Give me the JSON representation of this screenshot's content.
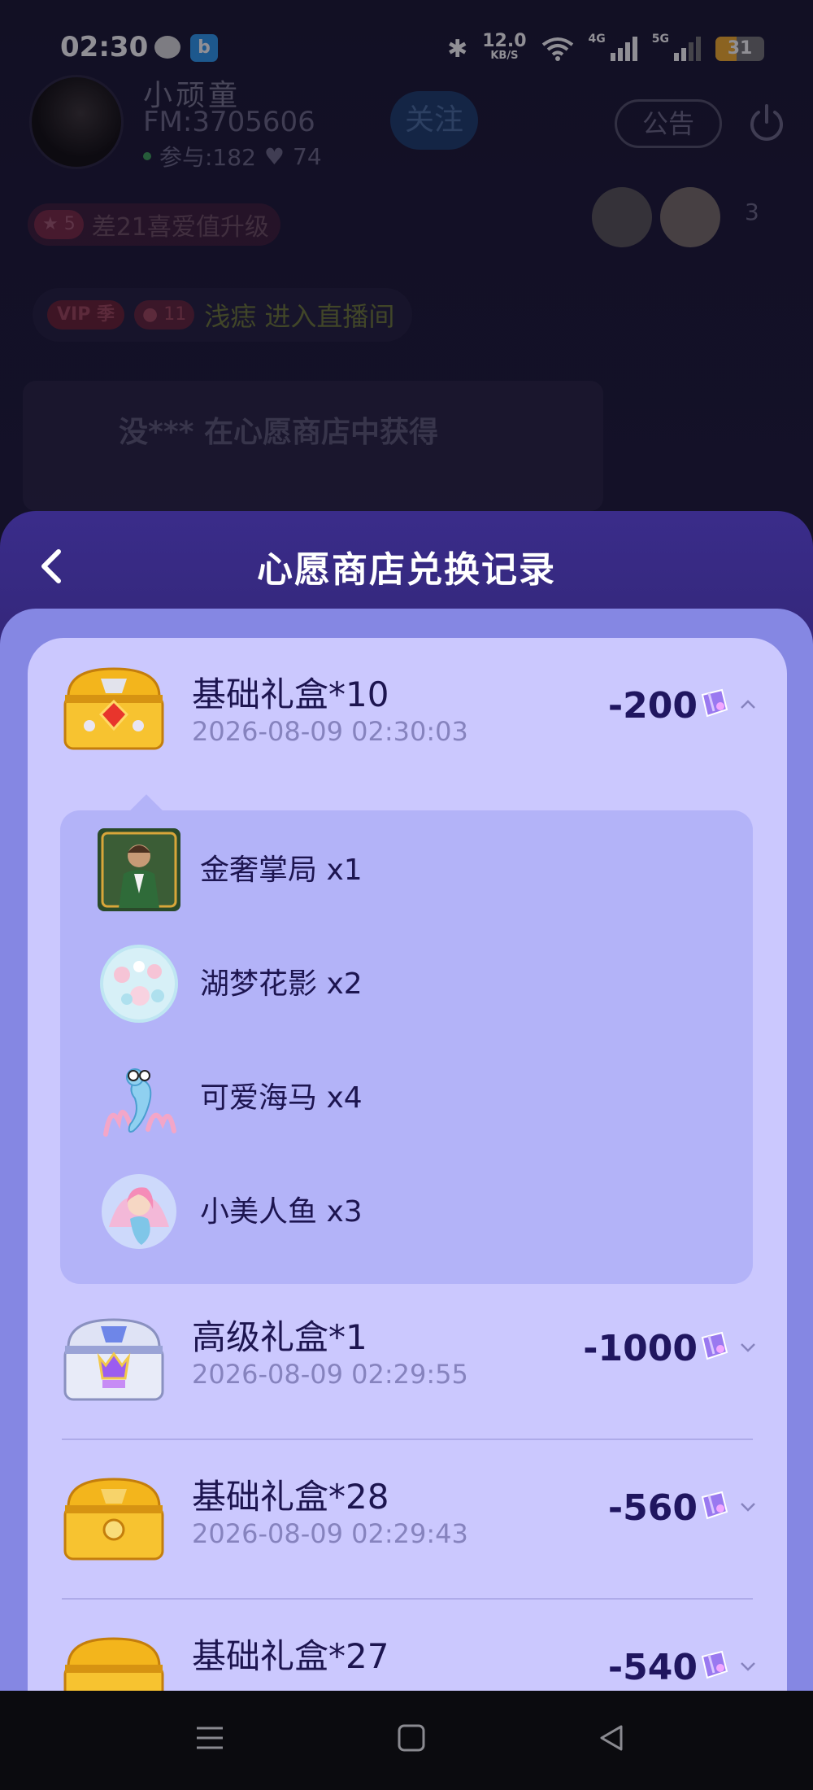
{
  "status_bar": {
    "time": "02:30",
    "app_icon_2": "b",
    "net_speed": "12.0",
    "net_unit": "KB/S",
    "net_type_1": "4G",
    "net_type_2": "5G",
    "battery": "31",
    "icons": [
      "wechat-icon",
      "app-icon",
      "bluetooth-icon",
      "wifi-icon",
      "signal-icon",
      "battery-icon"
    ]
  },
  "room": {
    "host_name": "小顽童",
    "host_fm": "FM:3705606",
    "participants": "参与:182",
    "likes": "74",
    "follow_label": "关注",
    "notice_label": "公告",
    "level_badge": "5",
    "level_text": "差21喜爱值升级",
    "viewer_count": "3",
    "vip_tag": "VIP",
    "vip_season": "季",
    "user_level": "11",
    "enter_text": "浅痣 进入直播间",
    "gift_message": "没*** 在心愿商店中获得"
  },
  "sheet": {
    "title": "心愿商店兑换记录",
    "records": [
      {
        "title": "基础礼盒*10",
        "time": "2026-08-09 02:30:03",
        "amount": "-200",
        "box": "gold",
        "expanded": true
      },
      {
        "title": "高级礼盒*1",
        "time": "2026-08-09 02:29:55",
        "amount": "-1000",
        "box": "silver",
        "expanded": false
      },
      {
        "title": "基础礼盒*28",
        "time": "2026-08-09 02:29:43",
        "amount": "-560",
        "box": "gold",
        "expanded": false
      },
      {
        "title": "基础礼盒*27",
        "time": "",
        "amount": "-540",
        "box": "gold",
        "expanded": false
      }
    ],
    "detail_items": [
      {
        "name": "金奢掌局 x1",
        "thumb": "gentleman"
      },
      {
        "name": "湖梦花影 x2",
        "thumb": "flower-orb"
      },
      {
        "name": "可爱海马 x4",
        "thumb": "seahorse"
      },
      {
        "name": "小美人鱼 x3",
        "thumb": "mermaid"
      }
    ]
  },
  "colors": {
    "sheet_header": "#3a2c8a",
    "sheet_body": "#8587e3",
    "card": "#cbc8fe",
    "detail_panel": "#b3b3f8",
    "text_primary": "#1d1550",
    "text_time": "#8683be"
  }
}
